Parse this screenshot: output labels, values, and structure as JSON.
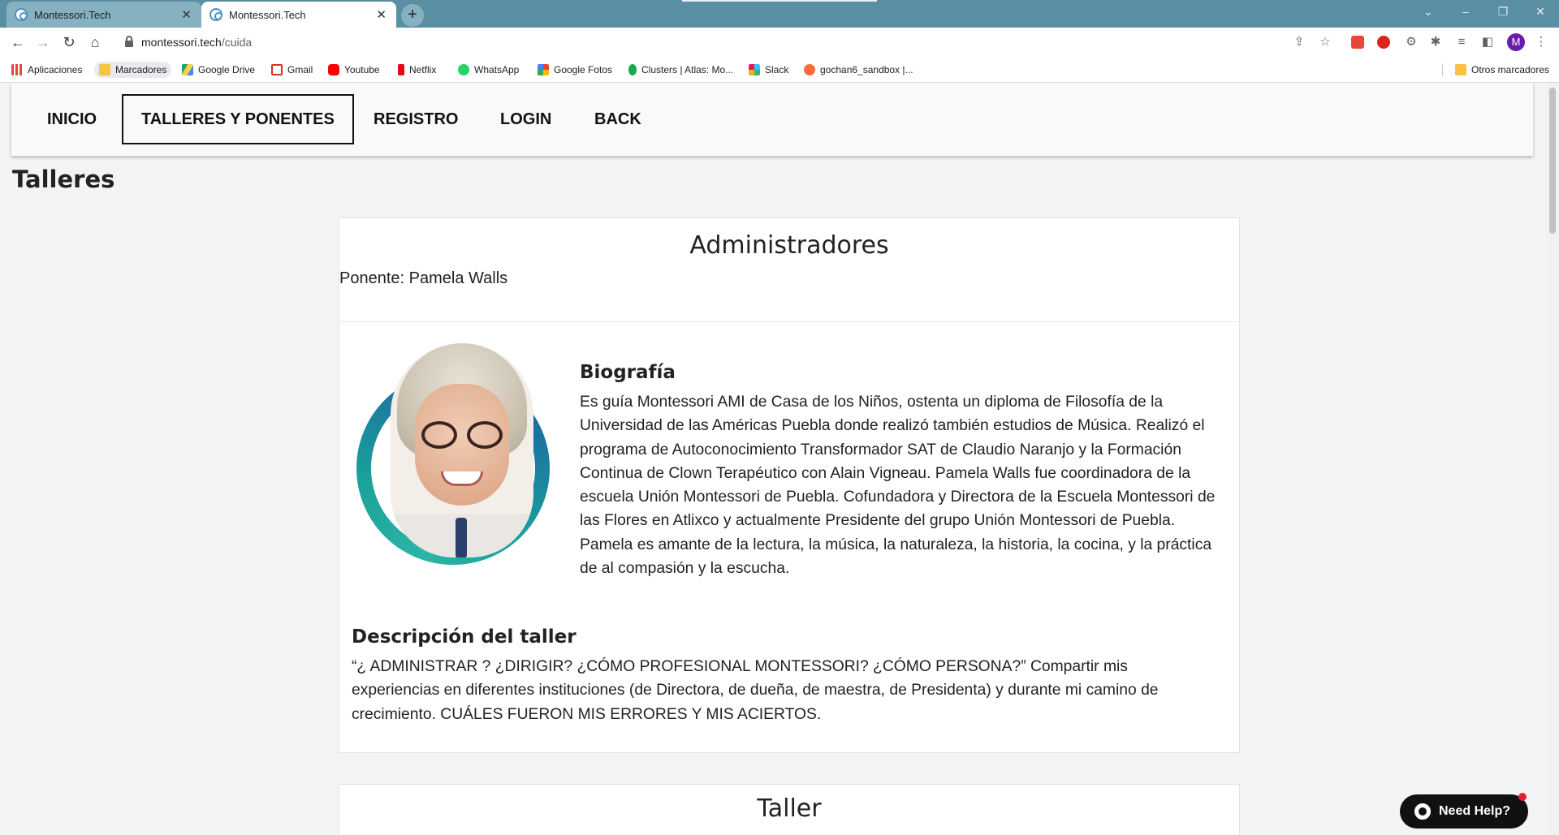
{
  "browser": {
    "tabs": [
      {
        "title": "Montessori.Tech",
        "close": "✕"
      },
      {
        "title": "Montessori.Tech",
        "close": "✕"
      }
    ],
    "new_tab": "+",
    "window_controls": {
      "dropdown": "⌄",
      "minimize": "–",
      "restore": "❐",
      "close": "✕"
    },
    "url_host": "montessori.tech",
    "url_path": "/cuida",
    "nav": {
      "back": "←",
      "forward": "→",
      "reload": "↻",
      "home": "⌂"
    },
    "toolbar_icons": {
      "share": "⇪",
      "star": "☆",
      "extensions": "✱",
      "menu": "⋮"
    },
    "profile_initial": "M",
    "bookmarks": [
      {
        "label": "Aplicaciones",
        "icon": "apps-grid-icon",
        "color": "#e8453c"
      },
      {
        "label": "Marcadores",
        "icon": "folder-icon",
        "color": "#f6c343"
      },
      {
        "label": "Google Drive",
        "icon": "google-drive-icon",
        "color": "#1fa463"
      },
      {
        "label": "Gmail",
        "icon": "gmail-icon",
        "color": "#d93025"
      },
      {
        "label": "Youtube",
        "icon": "youtube-icon",
        "color": "#ff0000"
      },
      {
        "label": "Netflix",
        "icon": "netflix-icon",
        "color": "#e50914"
      },
      {
        "label": "WhatsApp",
        "icon": "whatsapp-icon",
        "color": "#25d366"
      },
      {
        "label": "Google Fotos",
        "icon": "google-photos-icon",
        "color": "#fbbc04"
      },
      {
        "label": "Clusters | Atlas: Mo...",
        "icon": "mongodb-icon",
        "color": "#13aa52"
      },
      {
        "label": "Slack",
        "icon": "slack-icon",
        "color": "#4a154b"
      },
      {
        "label": "gochan6_sandbox |...",
        "icon": "postman-icon",
        "color": "#ff6c37"
      }
    ],
    "other_bookmarks": "Otros marcadores"
  },
  "nav": {
    "items": [
      "INICIO",
      "TALLERES Y PONENTES",
      "REGISTRO",
      "LOGIN",
      "BACK"
    ],
    "active": "TALLERES Y PONENTES"
  },
  "page": {
    "section_title": "Talleres",
    "cards": [
      {
        "title": "Administradores",
        "ponente": "Ponente: Pamela Walls",
        "bio_heading": "Biografía",
        "bio": "Es guía Montessori AMI de Casa de los Niños, ostenta un diploma de Filosofía de la Universidad de las Américas Puebla donde realizó también estudios de Música. Realizó el programa de Autoconocimiento Transformador SAT de Claudio Naranjo y la Formación Continua de Clown Terapéutico con Alain Vigneau. Pamela Walls fue coordinadora de la escuela Unión Montessori de Puebla. Cofundadora y Directora de la Escuela Montessori de las Flores en Atlixco y actualmente Presidente del grupo Unión Montessori de Puebla. Pamela es amante de la lectura, la música, la naturaleza, la historia, la cocina, y la práctica de al compasión y la escucha.",
        "desc_heading": "Descripción del taller",
        "desc": "“¿ ADMINISTRAR ? ¿DIRIGIR? ¿CÓMO PROFESIONAL MONTESSORI? ¿CÓMO PERSONA?” Compartir mis experiencias en diferentes instituciones (de Directora, de dueña, de maestra, de Presidenta) y durante mi camino de crecimiento. CUÁLES FUERON MIS ERRORES Y MIS ACIERTOS."
      },
      {
        "title": "Taller"
      }
    ],
    "help_button": "Need Help?"
  },
  "colors": {
    "tab_strip": "#5a8fa3",
    "page_bg": "#f3f4f6",
    "ring_teal": "#1aa39a",
    "ring_blue": "#23588f"
  }
}
